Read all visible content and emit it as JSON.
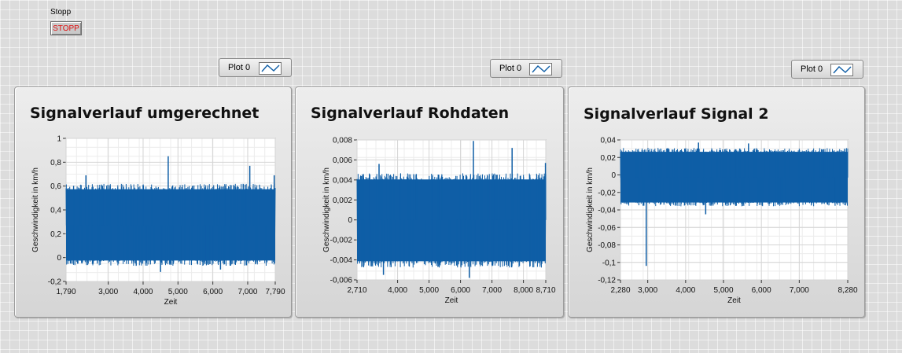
{
  "stop": {
    "label": "Stopp",
    "button": "STOPP"
  },
  "accent": "#0f5ea6",
  "charts": [
    {
      "legend": "Plot 0",
      "title": "Signalverlauf umgerechnet",
      "ylabel": "Geschwindigkeit in km/h",
      "xlabel": "Zeit",
      "yticks": [
        "1",
        "0,8",
        "0,6",
        "0,4",
        "0,2",
        "0",
        "-0,2"
      ],
      "xticks": [
        "1,790",
        "3,000",
        "4,000",
        "5,000",
        "6,000",
        "7,000",
        "7,790"
      ]
    },
    {
      "legend": "Plot 0",
      "title": "Signalverlauf Rohdaten",
      "ylabel": "Geschwindigkeit in km/h",
      "xlabel": "Zeit",
      "yticks": [
        "0,008",
        "0,006",
        "0,004",
        "0,002",
        "0",
        "-0,002",
        "-0,004",
        "-0,006"
      ],
      "xticks": [
        "2,710",
        "4,000",
        "5,000",
        "6,000",
        "7,000",
        "8,000",
        "8,710"
      ]
    },
    {
      "legend": "Plot 0",
      "title": "Signalverlauf Signal 2",
      "ylabel": "Geschwindigkeit in km/h",
      "xlabel": "Zeit",
      "yticks": [
        "0,04",
        "0,02",
        "0",
        "-0,02",
        "-0,04",
        "-0,06",
        "-0,08",
        "-0,1",
        "-0,12"
      ],
      "xticks": [
        "2,280",
        "3,000",
        "4,000",
        "5,000",
        "6,000",
        "7,000",
        "8,280"
      ]
    }
  ],
  "chart_data": [
    {
      "type": "line",
      "title": "Signalverlauf umgerechnet",
      "xlabel": "Zeit",
      "ylabel": "Geschwindigkeit in km/h",
      "xlim": [
        1790,
        7790
      ],
      "ylim": [
        -0.2,
        1
      ],
      "series": [
        {
          "name": "Plot 0",
          "band": [
            -0.05,
            0.6
          ],
          "center": 0.27,
          "spikes": [
            [
              2360,
              0.69
            ],
            [
              4720,
              0.85
            ],
            [
              7060,
              0.77
            ],
            [
              7760,
              0.69
            ]
          ],
          "dips": [
            [
              4500,
              -0.12
            ],
            [
              6220,
              -0.1
            ]
          ]
        }
      ],
      "grid": true
    },
    {
      "type": "line",
      "title": "Signalverlauf Rohdaten",
      "xlabel": "Zeit",
      "ylabel": "Geschwindigkeit in km/h",
      "xlim": [
        2710,
        8710
      ],
      "ylim": [
        -0.006,
        0.008
      ],
      "series": [
        {
          "name": "Plot 0",
          "band": [
            -0.0045,
            0.0044
          ],
          "center": 0,
          "spikes": [
            [
              3410,
              0.0056
            ],
            [
              6410,
              0.0079
            ],
            [
              7640,
              0.0072
            ],
            [
              8700,
              0.0057
            ]
          ],
          "dips": [
            [
              6280,
              -0.0058
            ],
            [
              3550,
              -0.0055
            ]
          ]
        }
      ],
      "grid": true
    },
    {
      "type": "line",
      "title": "Signalverlauf Signal 2",
      "xlabel": "Zeit",
      "ylabel": "Geschwindigkeit in km/h",
      "xlim": [
        2280,
        8280
      ],
      "ylim": [
        -0.12,
        0.04
      ],
      "series": [
        {
          "name": "Plot 0",
          "band": [
            -0.034,
            0.029
          ],
          "center": -0.003,
          "spikes": [
            [
              4340,
              0.037
            ],
            [
              5660,
              0.036
            ]
          ],
          "dips": [
            [
              2960,
              -0.104
            ],
            [
              4530,
              -0.045
            ]
          ]
        }
      ],
      "grid": true
    }
  ]
}
